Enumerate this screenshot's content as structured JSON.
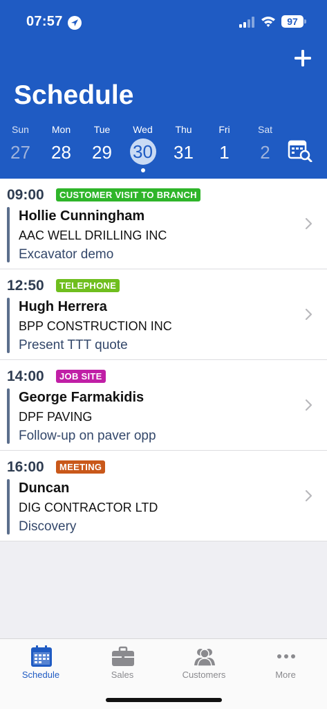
{
  "status": {
    "time": "07:57",
    "battery": "97"
  },
  "header": {
    "title": "Schedule"
  },
  "week": [
    {
      "name": "Sun",
      "num": "27",
      "muted": true
    },
    {
      "name": "Mon",
      "num": "28",
      "muted": false
    },
    {
      "name": "Tue",
      "num": "29",
      "muted": false
    },
    {
      "name": "Wed",
      "num": "30",
      "muted": false,
      "selected": true
    },
    {
      "name": "Thu",
      "num": "31",
      "muted": false
    },
    {
      "name": "Fri",
      "num": "1",
      "muted": false
    },
    {
      "name": "Sat",
      "num": "2",
      "muted": true
    }
  ],
  "appointments": [
    {
      "time": "09:00",
      "type": "CUSTOMER VISIT TO BRANCH",
      "color": "#2fb52a",
      "contact": "Hollie Cunningham",
      "company": "AAC WELL DRILLING INC",
      "note": "Excavator demo"
    },
    {
      "time": "12:50",
      "type": "TELEPHONE",
      "color": "#6fbe1e",
      "contact": "Hugh Herrera",
      "company": "BPP CONSTRUCTION INC",
      "note": "Present TTT quote"
    },
    {
      "time": "14:00",
      "type": "JOB SITE",
      "color": "#c01fa6",
      "contact": "George Farmakidis",
      "company": "DPF PAVING",
      "note": "Follow-up on paver opp"
    },
    {
      "time": "16:00",
      "type": "MEETING",
      "color": "#c9581a",
      "contact": "Duncan",
      "company": "DIG CONTRACTOR LTD",
      "note": "Discovery"
    }
  ],
  "tabs": [
    {
      "label": "Schedule",
      "icon": "calendar-icon",
      "active": true
    },
    {
      "label": "Sales",
      "icon": "briefcase-icon",
      "active": false
    },
    {
      "label": "Customers",
      "icon": "people-icon",
      "active": false
    },
    {
      "label": "More",
      "icon": "more-dots-icon",
      "active": false
    }
  ],
  "colors": {
    "brand": "#1f5bc3",
    "background": "#efeff3"
  }
}
